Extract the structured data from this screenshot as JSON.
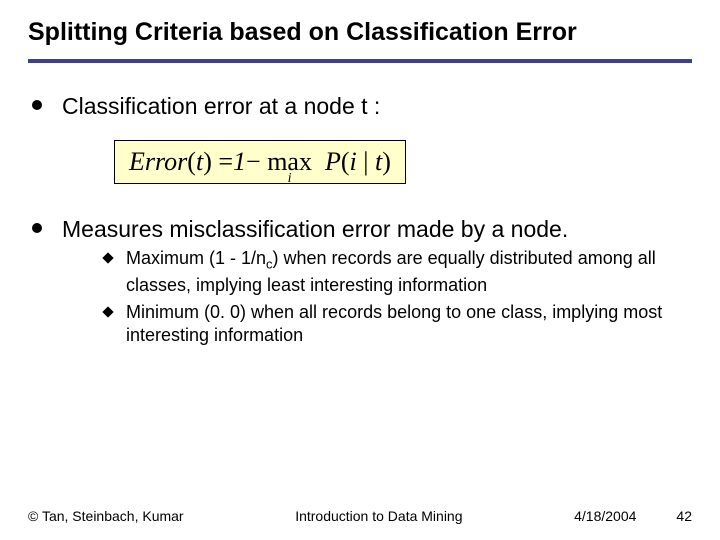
{
  "title": "Splitting Criteria based on Classification Error",
  "point1": "Classification error at a node t :",
  "formula": {
    "lhs": "Error",
    "arg_t": "t",
    "eq": "=",
    "one": "1",
    "minus": "−",
    "max": "max",
    "max_sub": "i",
    "P": "P",
    "i": "i",
    "bar": "|",
    "t2": "t"
  },
  "point2": "Measures misclassification error made by a node.",
  "sub1_a": "Maximum (1 - 1/n",
  "sub1_c": "c",
  "sub1_b": ") when records are equally distributed among all classes, implying least interesting information",
  "sub2": "Minimum (0. 0) when all records belong to one class, implying most interesting information",
  "footer": {
    "authors": "© Tan, Steinbach, Kumar",
    "course": "Introduction to Data Mining",
    "date": "4/18/2004",
    "page": "42"
  }
}
